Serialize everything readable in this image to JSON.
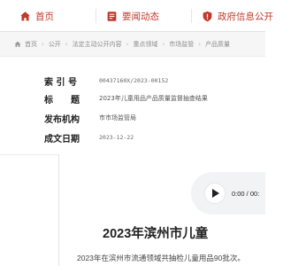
{
  "nav": {
    "items": [
      {
        "label": "首页",
        "icon": "home-icon"
      },
      {
        "label": "要闻动态",
        "icon": "document-icon"
      },
      {
        "label": "政府信息公开",
        "icon": "shield-icon"
      }
    ],
    "accent_color": "#c0392b"
  },
  "breadcrumb": {
    "items": [
      "首页",
      "公开",
      "法定主动公开内容",
      "重点领域",
      "市场监管",
      "产品质量"
    ],
    "home_icon": "home-icon"
  },
  "meta": {
    "index_label": "索 引 号",
    "index_value": "00437160X/2023-00152",
    "title_label": "标　　题",
    "title_value": "2023年儿童用品产品质量监督抽查结果",
    "org_label": "发布机构",
    "org_value": "市市场监管局",
    "date_label": "成文日期",
    "date_value": "2023-12-22"
  },
  "player": {
    "time": "0:00 / 00:",
    "play_icon": "play-icon"
  },
  "article": {
    "title": "2023年滨州市儿童",
    "paragraph": "2023年在滨州市流通领域共抽检儿童用品90批次。"
  }
}
